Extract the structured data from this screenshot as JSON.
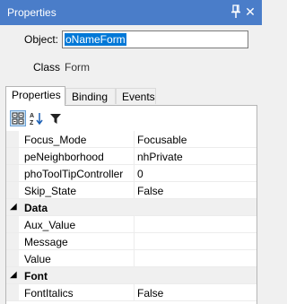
{
  "window": {
    "title": "Properties",
    "pin_icon": "pin-icon",
    "close_icon": "close-icon"
  },
  "header": {
    "object_label": "Object:",
    "object_value": "oNameForm",
    "class_label": "Class",
    "class_value": "Form"
  },
  "tabs": [
    {
      "label": "Properties",
      "active": true
    },
    {
      "label": "Binding",
      "active": false
    },
    {
      "label": "Events",
      "active": false
    }
  ],
  "toolbar": {
    "categorized_icon": "categorized-icon",
    "alphabetical_icon": "sort-alphabetical-icon",
    "filter_icon": "filter-icon"
  },
  "grid": {
    "rows": [
      {
        "type": "prop",
        "name": "Focus_Mode",
        "value": "Focusable"
      },
      {
        "type": "prop",
        "name": "peNeighborhood",
        "value": "nhPrivate"
      },
      {
        "type": "prop",
        "name": "phoToolTipController",
        "value": "0"
      },
      {
        "type": "prop",
        "name": "Skip_State",
        "value": "False"
      },
      {
        "type": "category",
        "name": "Data"
      },
      {
        "type": "prop",
        "name": "Aux_Value",
        "value": ""
      },
      {
        "type": "prop",
        "name": "Message",
        "value": ""
      },
      {
        "type": "prop",
        "name": "Value",
        "value": ""
      },
      {
        "type": "category",
        "name": "Font"
      },
      {
        "type": "prop",
        "name": "FontItalics",
        "value": "False"
      }
    ]
  },
  "colors": {
    "titlebar": "#4a7dc9",
    "selection": "#0078d7",
    "gutter": "#f0f0f0"
  }
}
